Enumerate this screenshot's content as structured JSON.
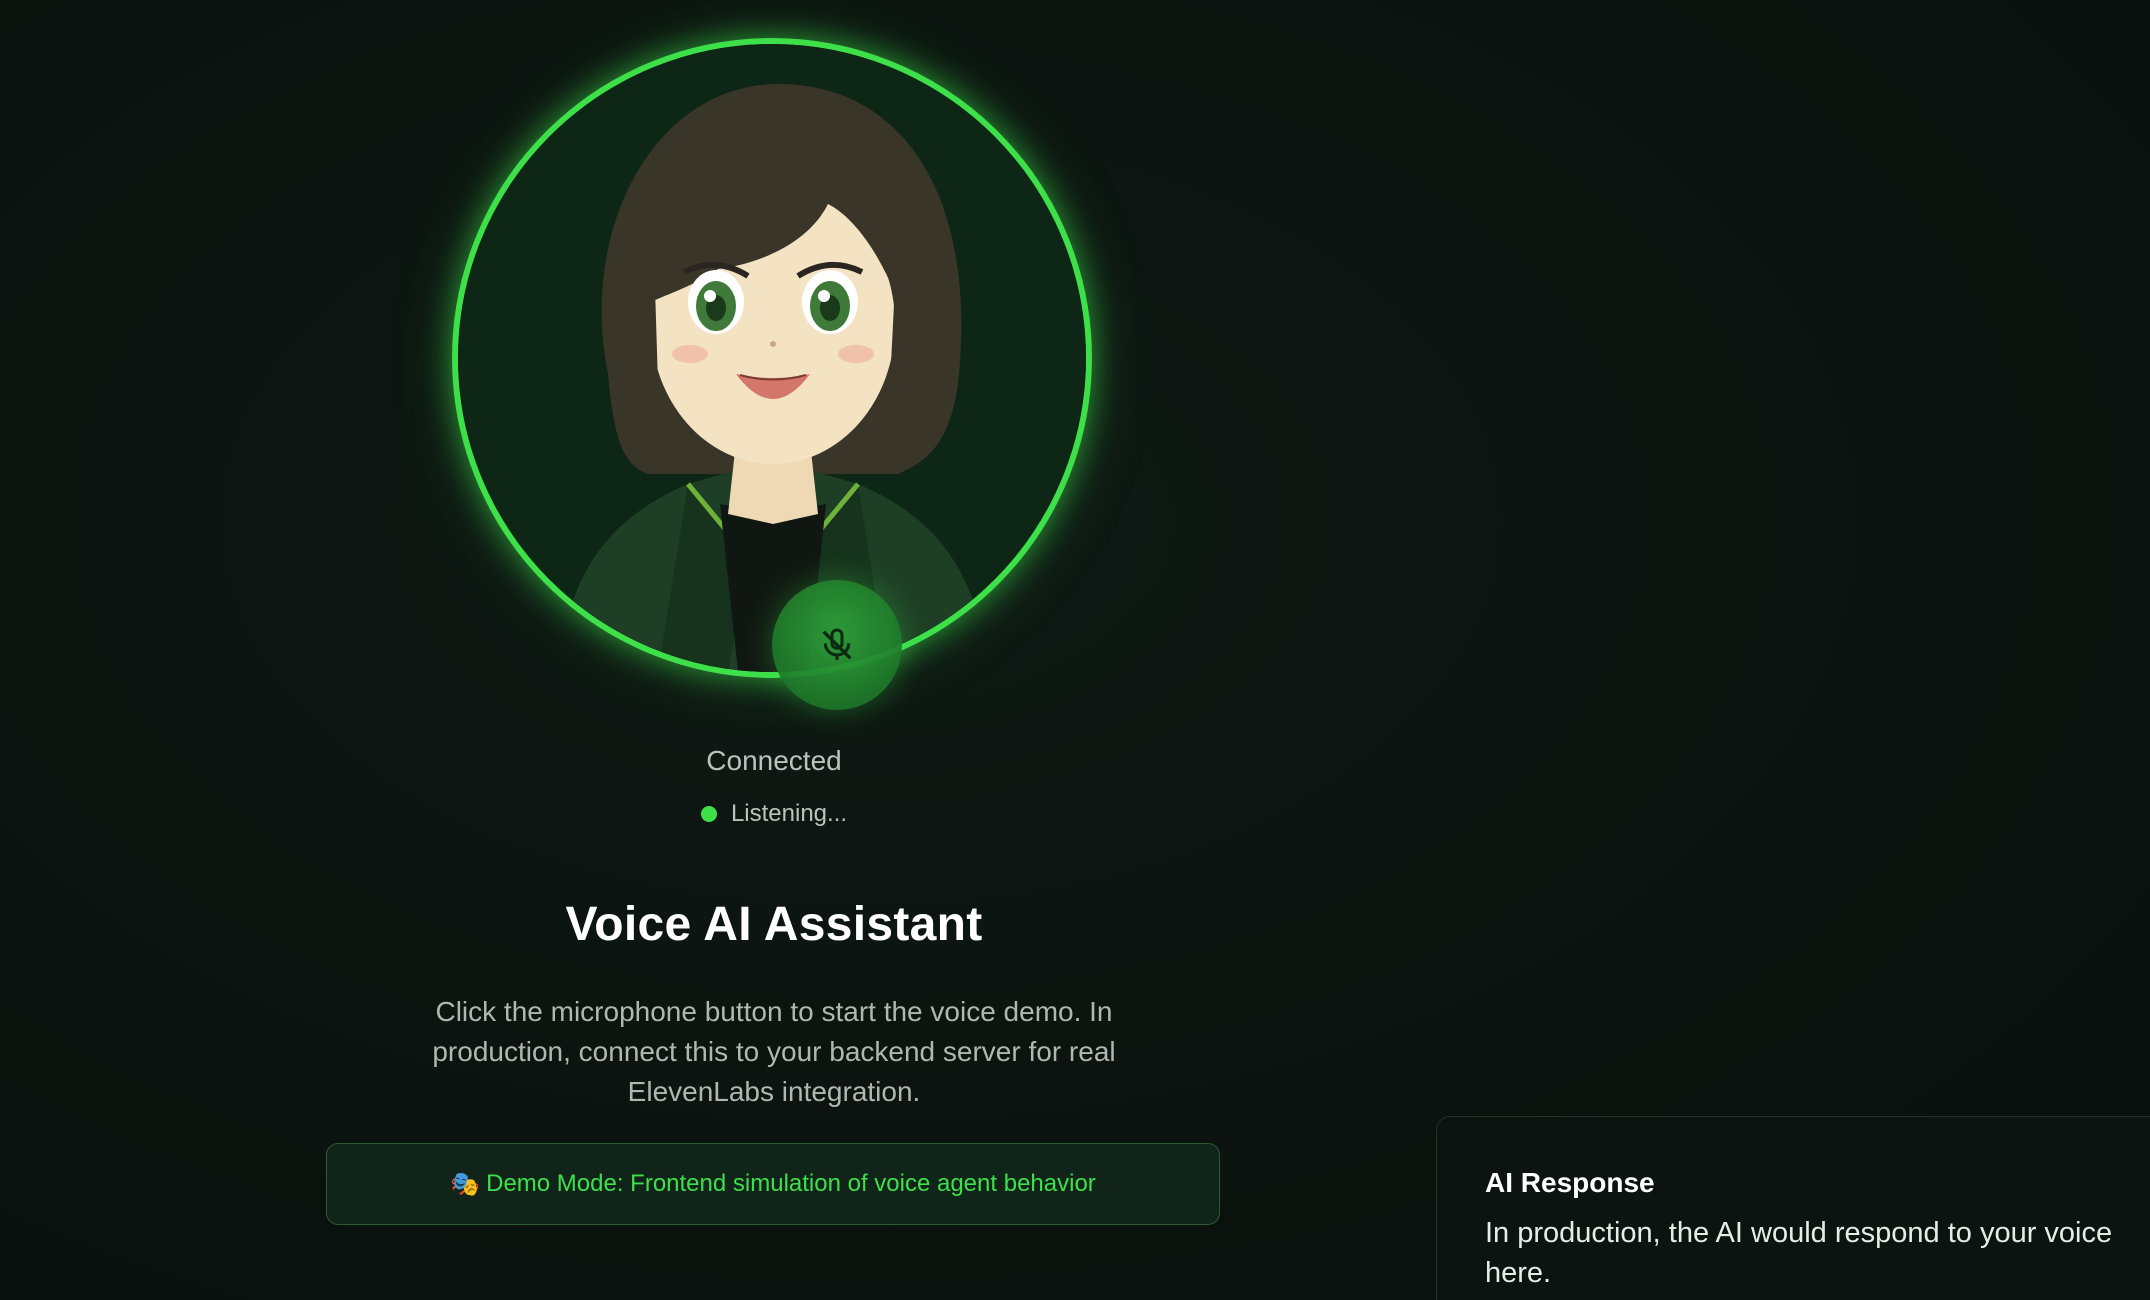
{
  "status": {
    "connection": "Connected",
    "listening": "Listening..."
  },
  "hero": {
    "title": "Voice AI Assistant",
    "description": "Click the microphone button to start the voice demo. In production, connect this to your backend server for real ElevenLabs integration."
  },
  "demo_banner": {
    "emoji": "🎭",
    "text": "Demo Mode: Frontend simulation of voice agent behavior"
  },
  "ai_response": {
    "title": "AI Response",
    "body": "In production, the AI would respond to your voice here."
  },
  "icons": {
    "mic": "mic-off-icon",
    "avatar": "anime-avatar"
  },
  "colors": {
    "accent": "#3ee04a",
    "background": "#0b1410"
  }
}
